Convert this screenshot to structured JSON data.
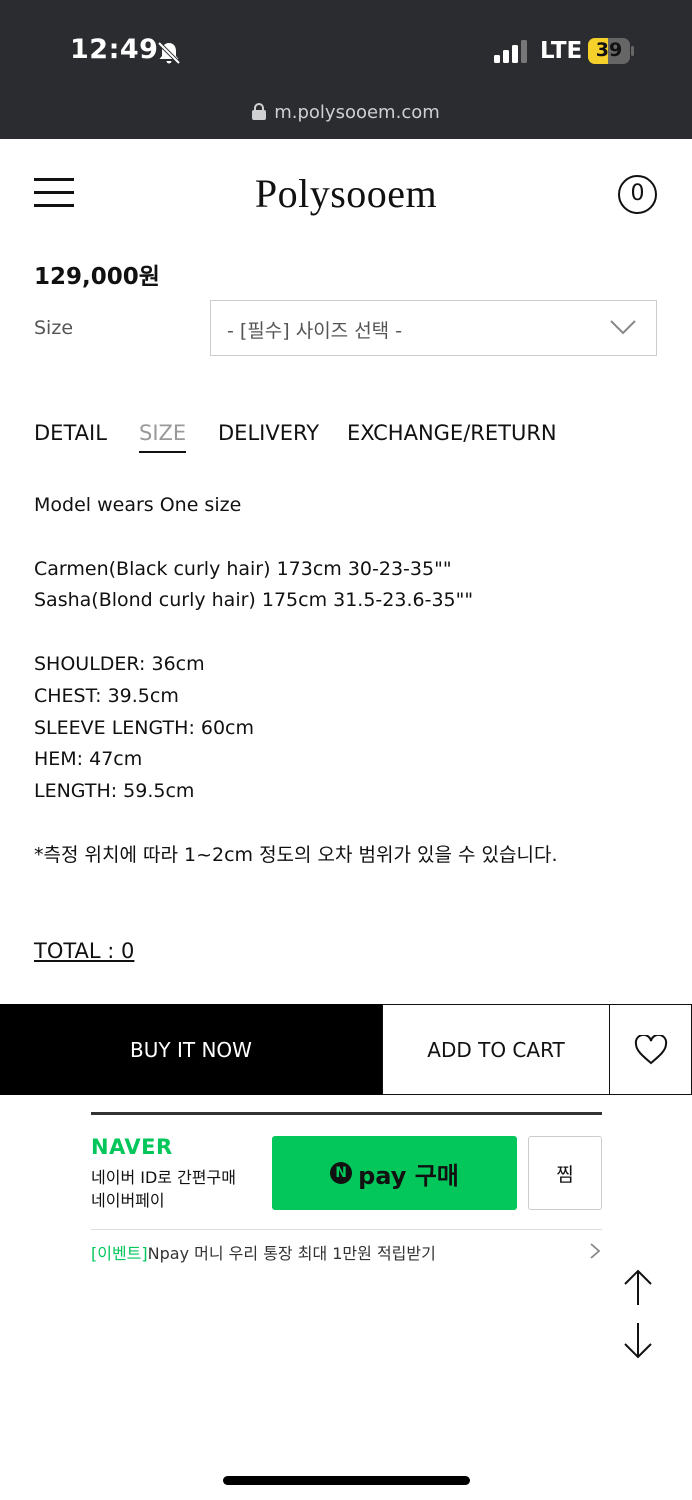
{
  "status_bar": {
    "time": "12:49",
    "network": "LTE",
    "battery": "39",
    "url": "m.polysooem.com"
  },
  "header": {
    "logo": "Polysooem",
    "cart_count": "0"
  },
  "product": {
    "price": "129,000원",
    "size_label": "Size",
    "size_select_placeholder": "- [필수] 사이즈 선택 -"
  },
  "tabs": [
    {
      "label": "DETAIL",
      "active": false
    },
    {
      "label": "SIZE",
      "active": true
    },
    {
      "label": "DELIVERY",
      "active": false
    },
    {
      "label": "EXCHANGE/RETURN",
      "active": false
    }
  ],
  "size_info": {
    "model_note": "Model wears One size",
    "models": [
      "Carmen(Black curly hair) 173cm 30-23-35\"\"",
      "Sasha(Blond curly hair) 175cm 31.5-23.6-35\"\""
    ],
    "measurements": [
      "SHOULDER: 36cm",
      "CHEST: 39.5cm",
      "SLEEVE LENGTH: 60cm",
      "HEM: 47cm",
      "LENGTH: 59.5cm"
    ],
    "disclaimer": "*측정 위치에 따라 1~2cm 정도의 오차 범위가 있을 수 있습니다."
  },
  "total": "TOTAL : 0",
  "actions": {
    "buy_now": "BUY IT NOW",
    "add_to_cart": "ADD TO CART"
  },
  "naver_pay": {
    "logo": "NAVER",
    "sub1": "네이버 ID로 간편구매",
    "sub2": "네이버페이",
    "npay_icon": "N",
    "button_label": "pay 구매",
    "zzim_label": "찜",
    "event_tag": "[이벤트]",
    "event_text": "Npay 머니 우리 통장 최대 1만원 적립받기"
  },
  "colors": {
    "naver_green": "#03c75a",
    "status_bar_bg": "#2b2c30",
    "battery_yellow": "#f5cf2a"
  }
}
